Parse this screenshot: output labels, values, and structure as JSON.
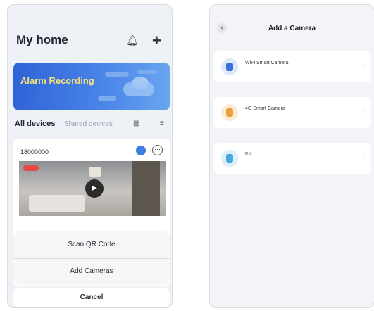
{
  "left_phone": {
    "status": {
      "left": "",
      "time": "",
      "right": ""
    },
    "title": "My home",
    "subtitle": "",
    "banner": {
      "title": "Alarm Recording",
      "subtitle": ""
    },
    "tabs": {
      "all": "All devices",
      "shared": "Shared devices"
    },
    "device": {
      "name": "18000000"
    },
    "sheet": {
      "scan": "Scan QR Code",
      "add": "Add Cameras",
      "cancel": "Cancel"
    },
    "icons": {
      "bell": "bell-icon",
      "plus": "plus-icon",
      "list": "list-icon",
      "more": "more-icon",
      "play": "play-icon"
    },
    "colors": {
      "banner": "#2f63d6",
      "banner_title": "#f4e27a"
    }
  },
  "right_phone": {
    "status": {
      "left": "",
      "time": "",
      "right": ""
    },
    "title": "Add a Camera",
    "options": [
      {
        "title": "WiFi Smart Camera",
        "subtitle": "",
        "icon": "wifi-camera-icon",
        "color": "#dfe9fb",
        "accent": "#3b6fd8"
      },
      {
        "title": "4G Smart Camera",
        "subtitle": "",
        "icon": "4g-camera-icon",
        "color": "#fcebd3",
        "accent": "#e6a23c"
      },
      {
        "title": "Kit",
        "subtitle": "",
        "icon": "kit-icon",
        "color": "#dcf0fb",
        "accent": "#48a9e0"
      }
    ]
  }
}
